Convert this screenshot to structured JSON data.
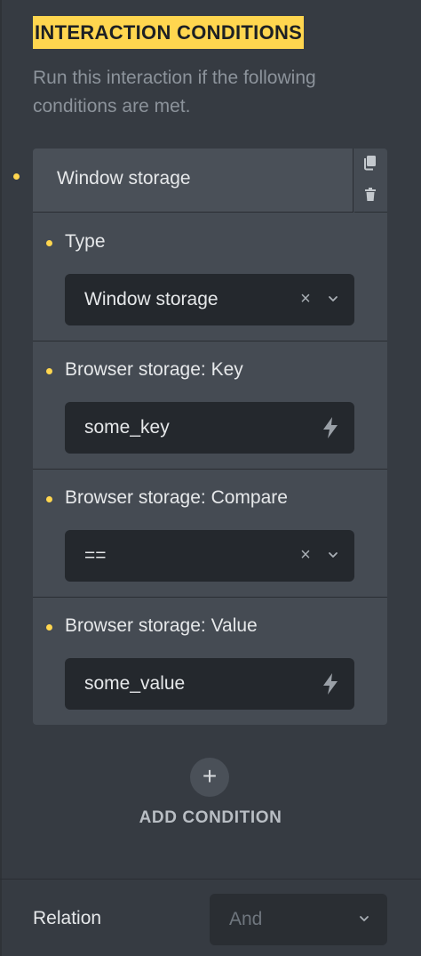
{
  "section": {
    "title": "INTERACTION CONDITIONS",
    "description": "Run this interaction if the following conditions are met."
  },
  "condition": {
    "header_label": "Window storage",
    "actions": [
      {
        "icon": "copy-icon"
      },
      {
        "icon": "trash-icon"
      }
    ],
    "fields": {
      "type": {
        "label": "Type",
        "value": "Window storage",
        "control": "select"
      },
      "key": {
        "label": "Browser storage: Key",
        "value": "some_key",
        "control": "dynamic-input"
      },
      "compare": {
        "label": "Browser storage: Compare",
        "value": "==",
        "control": "select"
      },
      "value": {
        "label": "Browser storage: Value",
        "value": "some_value",
        "control": "dynamic-input"
      }
    },
    "clear_glyph": "×"
  },
  "add": {
    "icon": "plus-icon",
    "glyph": "+",
    "label": "ADD CONDITION"
  },
  "relation": {
    "label": "Relation",
    "value": "And"
  },
  "colors": {
    "background": "#363b42",
    "card": "#454b53",
    "control": "#24282d",
    "accent": "#ffd64f"
  }
}
